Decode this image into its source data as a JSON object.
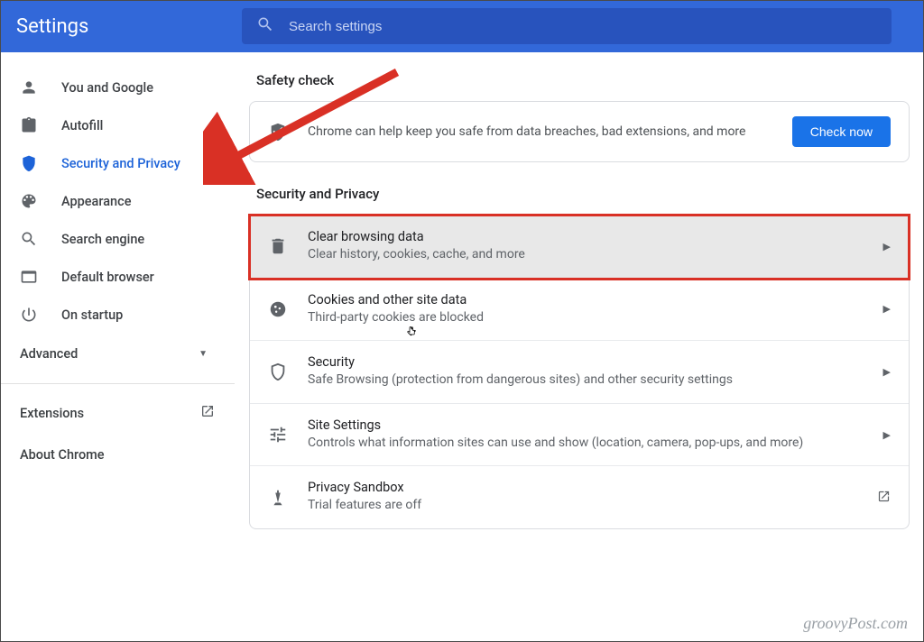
{
  "header": {
    "title": "Settings",
    "search_placeholder": "Search settings"
  },
  "sidebar": {
    "items": [
      {
        "icon": "person",
        "label": "You and Google"
      },
      {
        "icon": "clipboard",
        "label": "Autofill"
      },
      {
        "icon": "shield",
        "label": "Security and Privacy",
        "active": true
      },
      {
        "icon": "palette",
        "label": "Appearance"
      },
      {
        "icon": "search",
        "label": "Search engine"
      },
      {
        "icon": "browser",
        "label": "Default browser"
      },
      {
        "icon": "power",
        "label": "On startup"
      }
    ],
    "advanced_label": "Advanced",
    "extensions_label": "Extensions",
    "about_label": "About Chrome"
  },
  "main": {
    "safety_heading": "Safety check",
    "safety_text": "Chrome can help keep you safe from data breaches, bad extensions, and more",
    "check_now_label": "Check now",
    "sp_heading": "Security and Privacy",
    "rows": [
      {
        "icon": "trash",
        "title": "Clear browsing data",
        "sub": "Clear history, cookies, cache, and more",
        "selected": true
      },
      {
        "icon": "cookie",
        "title": "Cookies and other site data",
        "sub": "Third-party cookies are blocked"
      },
      {
        "icon": "shield-outline",
        "title": "Security",
        "sub": "Safe Browsing (protection from dangerous sites) and other security settings"
      },
      {
        "icon": "tune",
        "title": "Site Settings",
        "sub": "Controls what information sites can use and show (location, camera, pop-ups, and more)"
      },
      {
        "icon": "flask",
        "title": "Privacy Sandbox",
        "sub": "Trial features are off"
      }
    ]
  },
  "watermark": "groovyPost.com"
}
